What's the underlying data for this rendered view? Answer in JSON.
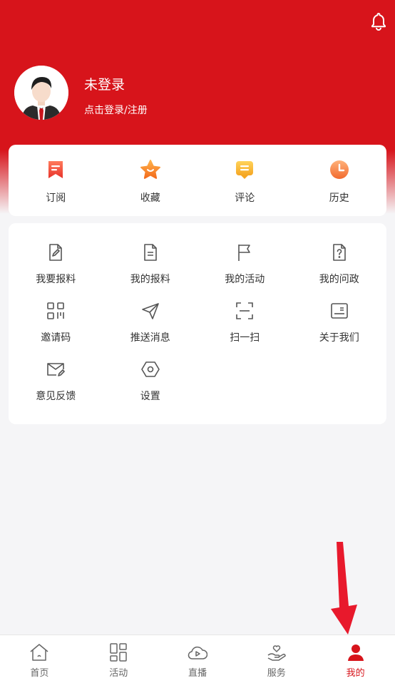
{
  "colors": {
    "brand_red": "#d7141b",
    "background": "#f5f5f7",
    "text": "#333333",
    "icon_gray": "#555555"
  },
  "header": {
    "bell_icon": "bell-icon",
    "user_name": "未登录",
    "login_hint": "点击登录/注册"
  },
  "quick": [
    {
      "label": "订阅",
      "icon": "subscribe-icon"
    },
    {
      "label": "收藏",
      "icon": "favorite-star-icon"
    },
    {
      "label": "评论",
      "icon": "comment-icon"
    },
    {
      "label": "历史",
      "icon": "history-clock-icon"
    }
  ],
  "menu": [
    {
      "label": "我要报料",
      "icon": "edit-document-icon"
    },
    {
      "label": "我的报料",
      "icon": "document-icon"
    },
    {
      "label": "我的活动",
      "icon": "flag-icon"
    },
    {
      "label": "我的问政",
      "icon": "question-document-icon"
    },
    {
      "label": "邀请码",
      "icon": "qr-code-icon"
    },
    {
      "label": "推送消息",
      "icon": "send-icon"
    },
    {
      "label": "扫一扫",
      "icon": "scan-icon"
    },
    {
      "label": "关于我们",
      "icon": "info-card-icon"
    },
    {
      "label": "意见反馈",
      "icon": "feedback-mail-icon"
    },
    {
      "label": "设置",
      "icon": "settings-hexagon-icon"
    }
  ],
  "nav": [
    {
      "label": "首页",
      "icon": "home-icon",
      "active": false
    },
    {
      "label": "活动",
      "icon": "activity-grid-icon",
      "active": false
    },
    {
      "label": "直播",
      "icon": "live-cloud-icon",
      "active": false
    },
    {
      "label": "服务",
      "icon": "service-hand-heart-icon",
      "active": false
    },
    {
      "label": "我的",
      "icon": "profile-icon",
      "active": true
    }
  ]
}
